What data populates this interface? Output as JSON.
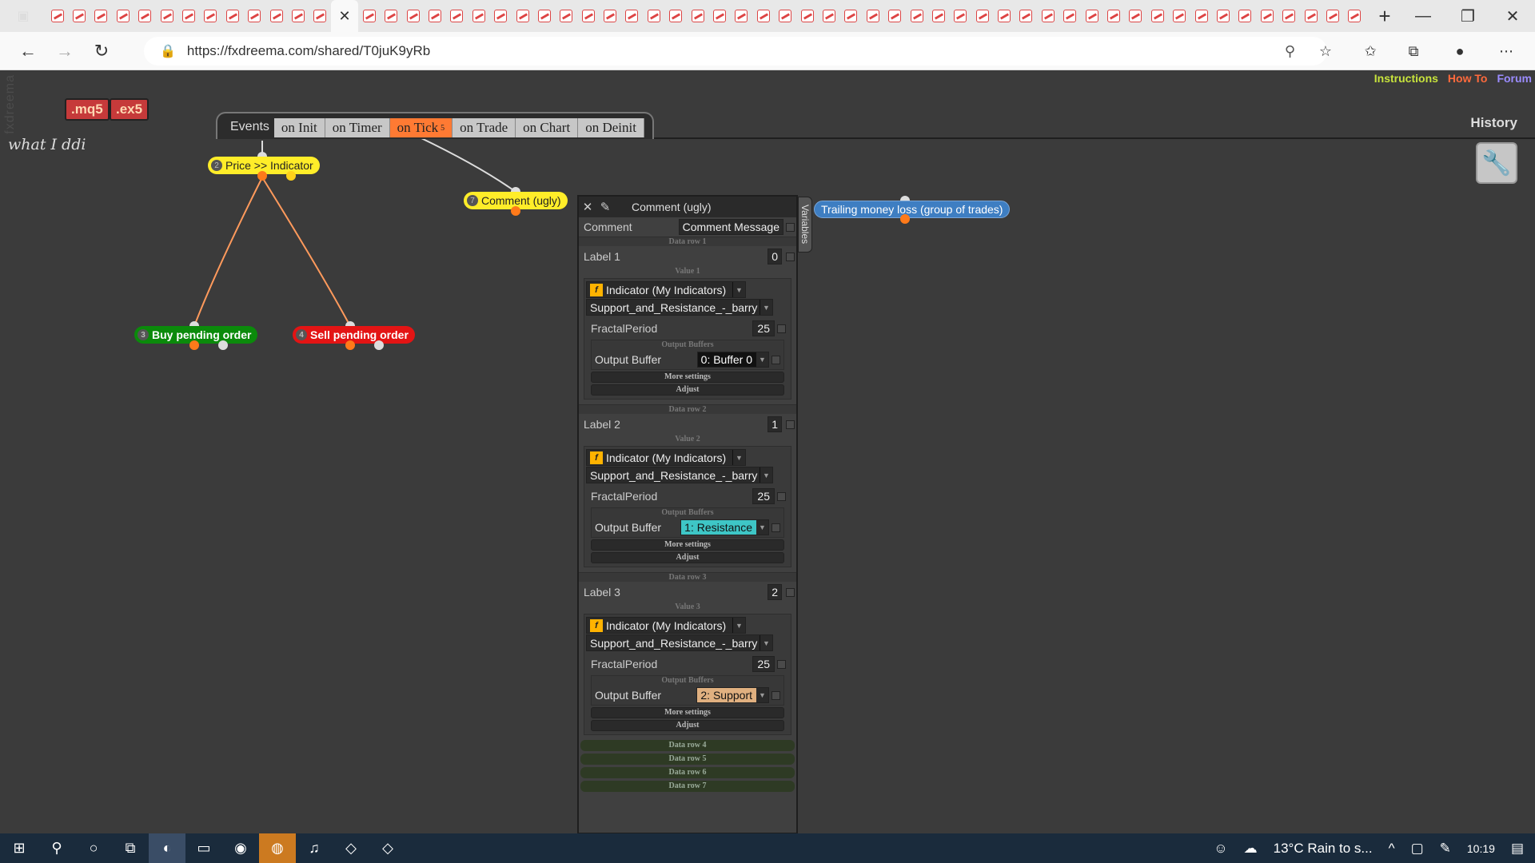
{
  "browser": {
    "url": "https://fxdreema.com/shared/T0juK9yRb",
    "tab_count": 62
  },
  "app": {
    "side_logo": "fxdreema",
    "top_links": [
      "Instructions",
      "How To",
      "Forum"
    ],
    "buttons": {
      "mq5": ".mq5",
      "ex5": ".ex5"
    },
    "project_title": "what I ddi",
    "history_label": "History",
    "events_label": "Events",
    "event_tabs": [
      {
        "label": "on Init"
      },
      {
        "label": "on Timer"
      },
      {
        "label": "on Tick",
        "badge": "5"
      },
      {
        "label": "on Trade"
      },
      {
        "label": "on Chart"
      },
      {
        "label": "on Deinit"
      }
    ]
  },
  "blocks": {
    "price_indicator": {
      "num": "2",
      "label": "Price >> Indicator"
    },
    "comment_ugly": {
      "num": "7",
      "label": "Comment (ugly)"
    },
    "buy_pending": {
      "num": "3",
      "label": "Buy pending order"
    },
    "sell_pending": {
      "num": "4",
      "label": "Sell pending order"
    },
    "trailing": {
      "label": "Trailing money loss (group of trades)"
    }
  },
  "panel": {
    "title": "Comment (ugly)",
    "variables_tab": "Variables",
    "comment_label": "Comment",
    "comment_value": "Comment Message",
    "rows": [
      {
        "section": "Data row 1",
        "label": "Label 1",
        "label_value": "0",
        "value_section": "Value 1",
        "indicator": "Indicator (My Indicators)",
        "indicator_name": "Support_and_Resistance_-_barry",
        "param_name": "FractalPeriod",
        "param_value": "25",
        "ob_section": "Output Buffers",
        "ob_label": "Output Buffer",
        "ob_value": "0: Buffer 0",
        "ob_color": "#111111",
        "ob_text": "#ffffff",
        "more": "More settings",
        "adjust": "Adjust"
      },
      {
        "section": "Data row 2",
        "label": "Label 2",
        "label_value": "1",
        "value_section": "Value 2",
        "indicator": "Indicator (My Indicators)",
        "indicator_name": "Support_and_Resistance_-_barry",
        "param_name": "FractalPeriod",
        "param_value": "25",
        "ob_section": "Output Buffers",
        "ob_label": "Output Buffer",
        "ob_value": "1: Resistance",
        "ob_color": "#3ec6c6",
        "ob_text": "#111111",
        "more": "More settings",
        "adjust": "Adjust"
      },
      {
        "section": "Data row 3",
        "label": "Label 3",
        "label_value": "2",
        "value_section": "Value 3",
        "indicator": "Indicator (My Indicators)",
        "indicator_name": "Support_and_Resistance_-_barry",
        "param_name": "FractalPeriod",
        "param_value": "25",
        "ob_section": "Output Buffers",
        "ob_label": "Output Buffer",
        "ob_value": "2: Support",
        "ob_color": "#e0b080",
        "ob_text": "#111111",
        "more": "More settings",
        "adjust": "Adjust"
      }
    ],
    "collapsed_rows": [
      "Data row 4",
      "Data row 5",
      "Data row 6",
      "Data row 7"
    ]
  },
  "taskbar": {
    "weather": "13°C  Rain to s...",
    "time": "10:19"
  }
}
